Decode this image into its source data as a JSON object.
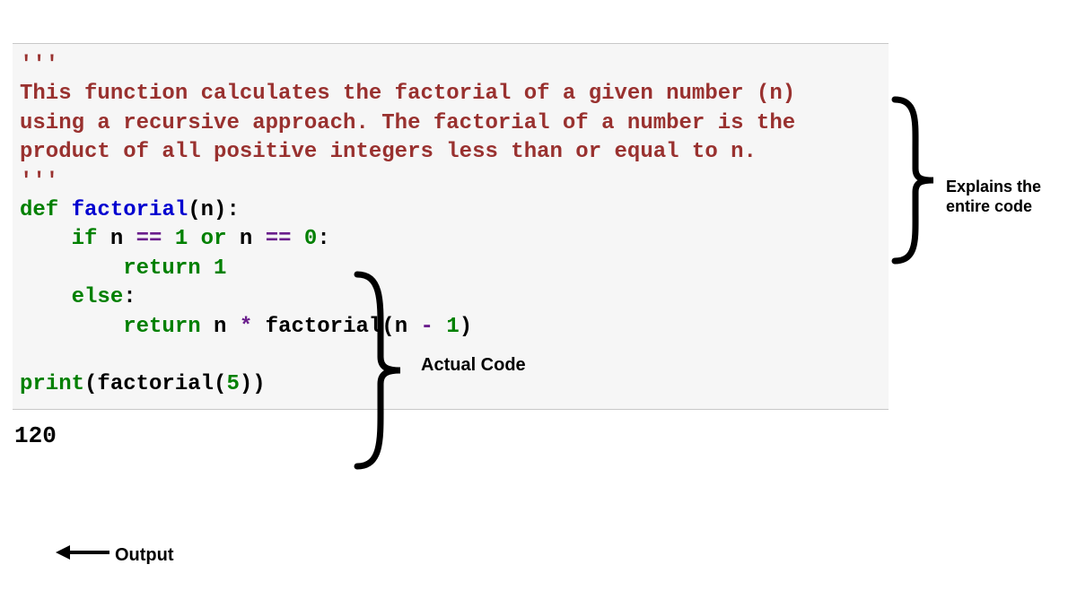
{
  "docstring": {
    "open": "'''",
    "line1": "This function calculates the factorial of a given number (n)",
    "line2": "using a recursive approach. The factorial of a number is the",
    "line3": "product of all positive integers less than or equal to n.",
    "close": "'''"
  },
  "code": {
    "def": "def",
    "fname": "factorial",
    "sig_open": "(n):",
    "if": "if",
    "var_n1": "n",
    "eq1": "==",
    "one": "1",
    "or": "or",
    "var_n2": "n",
    "eq2": "==",
    "zero": "0",
    "colon1": ":",
    "return1": "return",
    "ret_one": "1",
    "else": "else",
    "colon2": ":",
    "return2": "return",
    "var_n3": "n",
    "star": "*",
    "call": "factorial(n",
    "minus": "-",
    "one2": "1",
    "close_paren": ")",
    "print": "print",
    "printarg": "(factorial(",
    "five": "5",
    "print_close": "))"
  },
  "output": "120",
  "annotations": {
    "explains": "Explains the entire code",
    "actual": "Actual Code",
    "output": "Output"
  }
}
